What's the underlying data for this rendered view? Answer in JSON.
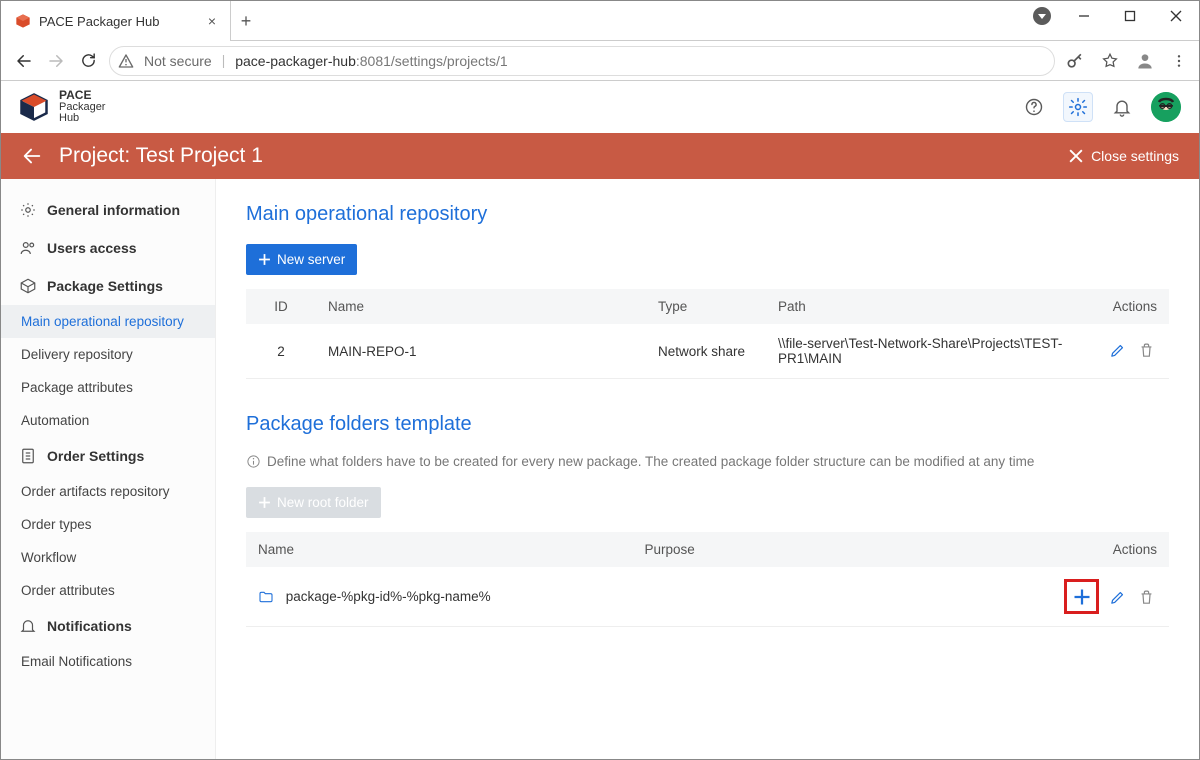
{
  "browser": {
    "tab_title": "PACE Packager Hub",
    "not_secure": "Not secure",
    "host": "pace-packager-hub",
    "port_path": ":8081/settings/projects/1"
  },
  "brand": {
    "line1": "PACE",
    "line2": "Packager",
    "line3": "Hub"
  },
  "topbar": {
    "title": "Project: Test Project 1",
    "close": "Close settings"
  },
  "sidebar": {
    "general": "General information",
    "users": "Users access",
    "package_settings": "Package Settings",
    "subs_pkg": {
      "main_repo": "Main operational repository",
      "delivery": "Delivery repository",
      "attrs": "Package attributes",
      "automation": "Automation"
    },
    "order_settings": "Order Settings",
    "subs_order": {
      "artifacts": "Order artifacts repository",
      "types": "Order types",
      "workflow": "Workflow",
      "attrs": "Order attributes"
    },
    "notifications": "Notifications",
    "subs_notif": {
      "email": "Email Notifications"
    }
  },
  "sections": {
    "repo_title": "Main operational repository",
    "new_server": "New server",
    "repo_table": {
      "cols": {
        "id": "ID",
        "name": "Name",
        "type": "Type",
        "path": "Path",
        "actions": "Actions"
      },
      "row": {
        "id": "2",
        "name": "MAIN-REPO-1",
        "type": "Network share",
        "path": "\\\\file-server\\Test-Network-Share\\Projects\\TEST-PR1\\MAIN"
      }
    },
    "folders_title": "Package folders template",
    "folders_hint": "Define what folders have to be created for every new package. The created package folder structure can be modified at any time",
    "new_root_folder": "New root folder",
    "folders_table": {
      "cols": {
        "name": "Name",
        "purpose": "Purpose",
        "actions": "Actions"
      },
      "row": {
        "name": "package-%pkg-id%-%pkg-name%"
      }
    }
  }
}
